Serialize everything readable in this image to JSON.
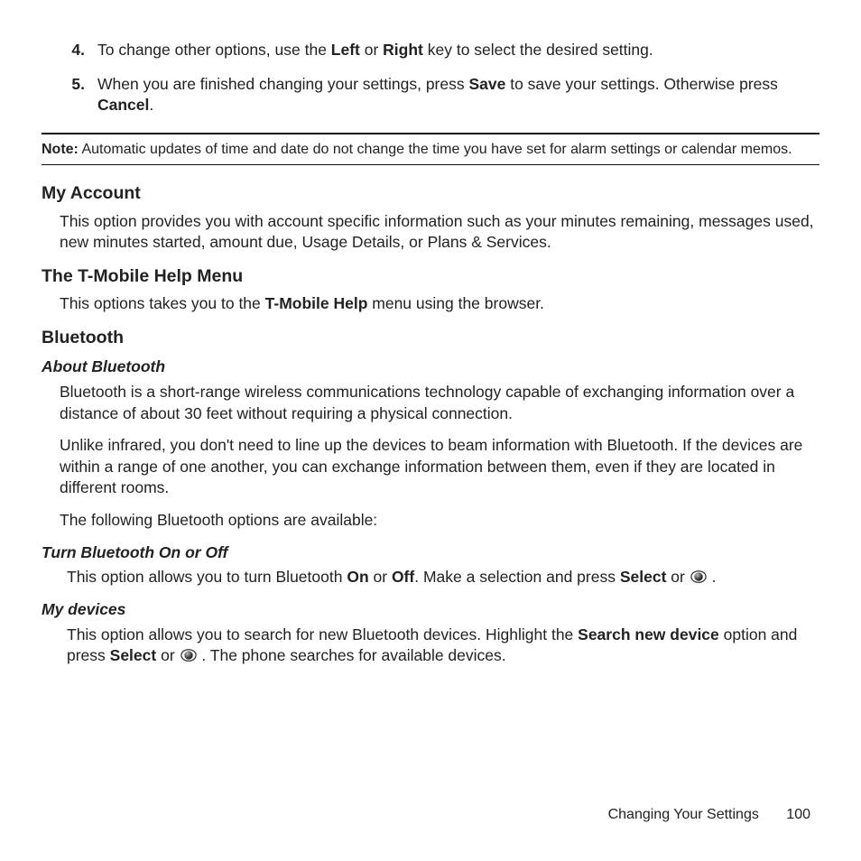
{
  "steps": [
    {
      "num": "4.",
      "parts": [
        "To change other options, use the ",
        "Left",
        " or ",
        "Right",
        " key to select the desired setting."
      ]
    },
    {
      "num": "5.",
      "parts": [
        "When you are finished changing your settings, press ",
        "Save",
        " to save your settings. Otherwise press ",
        "Cancel",
        "."
      ]
    }
  ],
  "note": {
    "label": "Note:",
    "text": " Automatic updates of time and date do not change the time you have set for alarm settings or calendar memos."
  },
  "sections": {
    "myAccount": {
      "title": "My Account",
      "body": "This option provides you with account specific information such as your minutes remaining, messages used, new minutes started, amount due, Usage Details, or Plans & Services."
    },
    "helpMenu": {
      "title": "The T-Mobile Help Menu",
      "pre": "This options takes you to the ",
      "bold": "T-Mobile Help",
      "post": " menu using the browser."
    },
    "bluetooth": {
      "title": "Bluetooth",
      "about": {
        "title": "About Bluetooth",
        "p1": "Bluetooth is a short-range wireless communications technology capable of exchanging information over a distance of about 30 feet without requiring a physical connection.",
        "p2": "Unlike infrared, you don't need to line up the devices to beam information with Bluetooth. If the devices are within a range of one another, you can exchange information between them, even if they are located in different rooms.",
        "p3": "The following Bluetooth options are available:"
      },
      "onoff": {
        "title": "Turn Bluetooth On or Off",
        "seg": [
          "This option allows you to turn Bluetooth ",
          "On",
          " or ",
          "Off",
          ". Make a selection and press ",
          "Select",
          " or  "
        ],
        "tail": " ."
      },
      "mydevices": {
        "title": "My devices",
        "seg": [
          "This option allows you to search for new Bluetooth devices. Highlight the ",
          "Search new device",
          " option and press ",
          "Select",
          " or  "
        ],
        "tail": " . The phone searches for available devices."
      }
    }
  },
  "footer": {
    "section": "Changing Your Settings",
    "page": "100"
  }
}
